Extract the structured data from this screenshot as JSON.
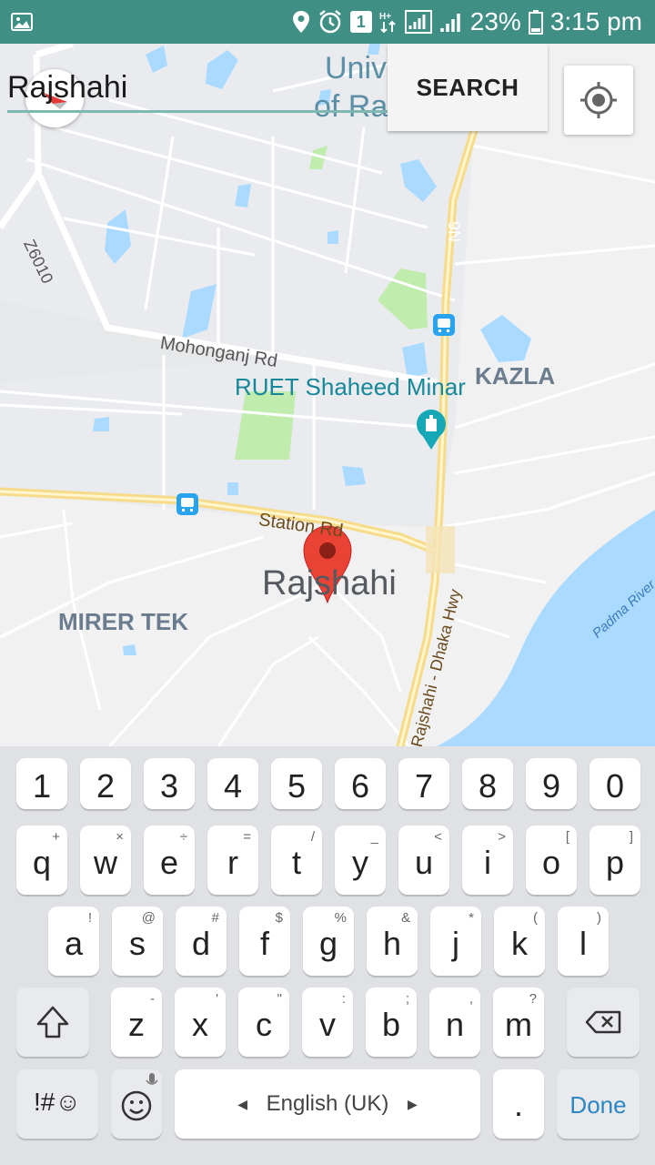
{
  "status_bar": {
    "battery_percent": "23%",
    "time": "3:15 pm",
    "notification_count": "1",
    "colors": {
      "background": "#3f8f84"
    }
  },
  "search": {
    "value": "Rajshahi",
    "button_label": "SEARCH"
  },
  "map": {
    "labels": {
      "university_1": "Univ",
      "university_2": "of Ra",
      "road_z6010": "Z6010",
      "road_n6": "N6",
      "mohonganj_rd": "Mohonganj Rd",
      "ruet_shaheed_minar": "RUET Shaheed Minar",
      "kazla": "KAZLA",
      "station_rd": "Station Rd",
      "rajshahi": "Rajshahi",
      "mirer_tek": "MIRER TEK",
      "dhaka_hwy": "Rajshahi - Dhaka Hwy",
      "padma_river": "Padma River"
    },
    "colors": {
      "water": "#aadaff",
      "park": "#c0ecae",
      "road_major": "#f8e29a",
      "marker": "#ea4335"
    }
  },
  "keyboard": {
    "numbers": [
      "1",
      "2",
      "3",
      "4",
      "5",
      "6",
      "7",
      "8",
      "9",
      "0"
    ],
    "row1": [
      {
        "key": "q",
        "sub": "+"
      },
      {
        "key": "w",
        "sub": "×"
      },
      {
        "key": "e",
        "sub": "÷"
      },
      {
        "key": "r",
        "sub": "="
      },
      {
        "key": "t",
        "sub": "/"
      },
      {
        "key": "y",
        "sub": "_"
      },
      {
        "key": "u",
        "sub": "<"
      },
      {
        "key": "i",
        "sub": ">"
      },
      {
        "key": "o",
        "sub": "["
      },
      {
        "key": "p",
        "sub": "]"
      }
    ],
    "row2": [
      {
        "key": "a",
        "sub": "!"
      },
      {
        "key": "s",
        "sub": "@"
      },
      {
        "key": "d",
        "sub": "#"
      },
      {
        "key": "f",
        "sub": "$"
      },
      {
        "key": "g",
        "sub": "%"
      },
      {
        "key": "h",
        "sub": "&"
      },
      {
        "key": "j",
        "sub": "*"
      },
      {
        "key": "k",
        "sub": "("
      },
      {
        "key": "l",
        "sub": ")"
      }
    ],
    "row3": [
      {
        "key": "z",
        "sub": "-"
      },
      {
        "key": "x",
        "sub": "'"
      },
      {
        "key": "c",
        "sub": "\""
      },
      {
        "key": "v",
        "sub": ":"
      },
      {
        "key": "b",
        "sub": ";"
      },
      {
        "key": "n",
        "sub": ","
      },
      {
        "key": "m",
        "sub": "?"
      }
    ],
    "symbols_label": "!#☺",
    "language_label": "English (UK)",
    "period_label": ".",
    "done_label": "Done"
  }
}
